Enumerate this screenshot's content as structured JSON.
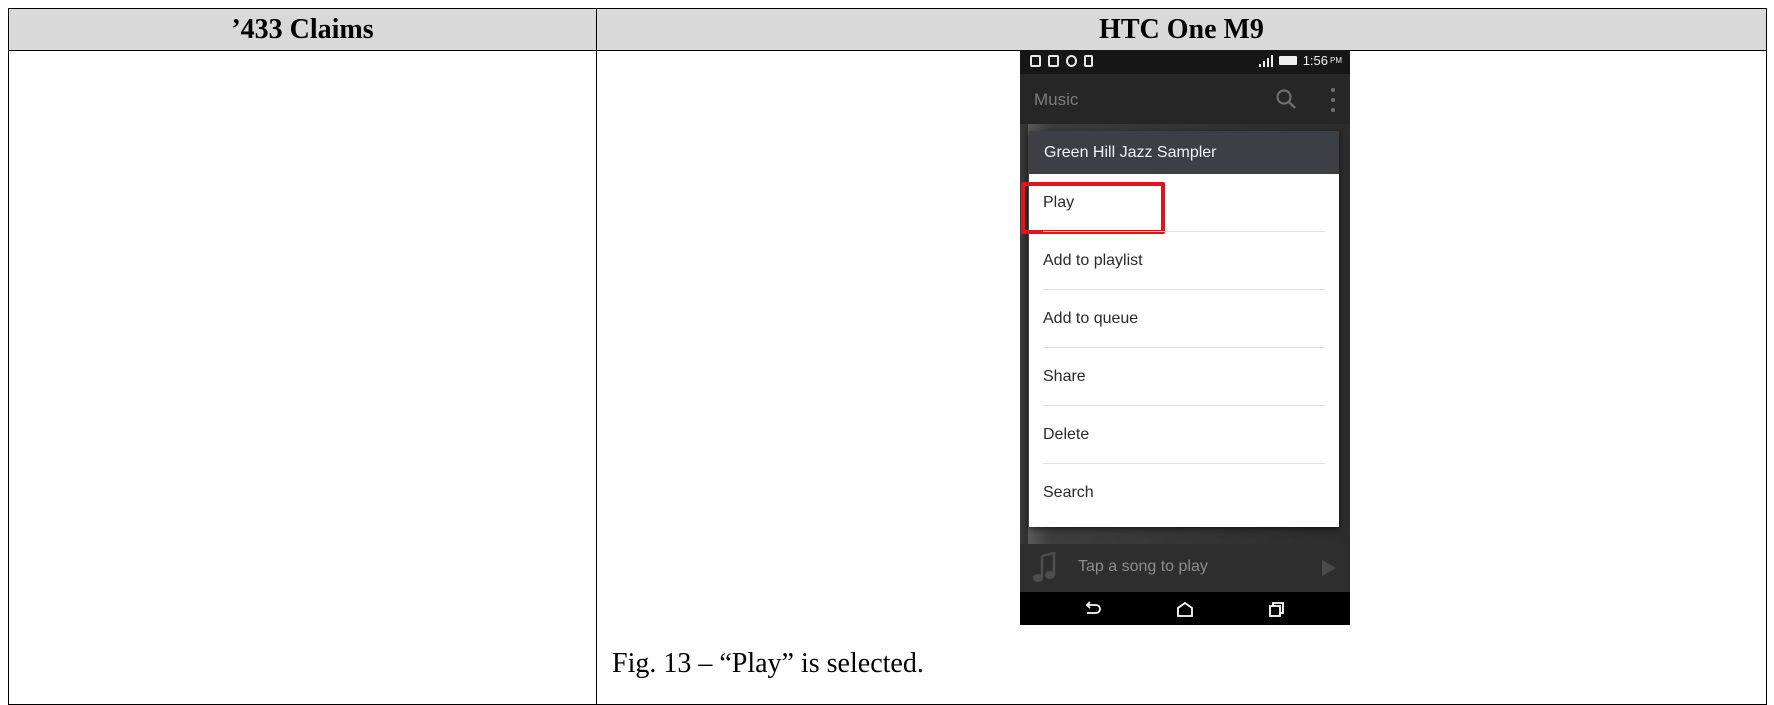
{
  "table": {
    "col_left_header": "’433 Claims",
    "col_right_header": "HTC One M9"
  },
  "phone": {
    "status_time": "1:56",
    "status_ampm": "PM",
    "app_title": "Music",
    "dialog_title": "Green Hill Jazz Sampler",
    "menu_items": [
      "Play",
      "Add to playlist",
      "Add to queue",
      "Share",
      "Delete",
      "Search"
    ],
    "selected_item": "Play",
    "now_playing_text": "Tap a song to play",
    "icons": [
      "search-icon",
      "more-icon",
      "music-note-icon",
      "play-icon",
      "back-icon",
      "home-icon",
      "recents-icon"
    ],
    "highlight_color": "#e3131b"
  },
  "caption": "Fig. 13 – “Play” is selected."
}
